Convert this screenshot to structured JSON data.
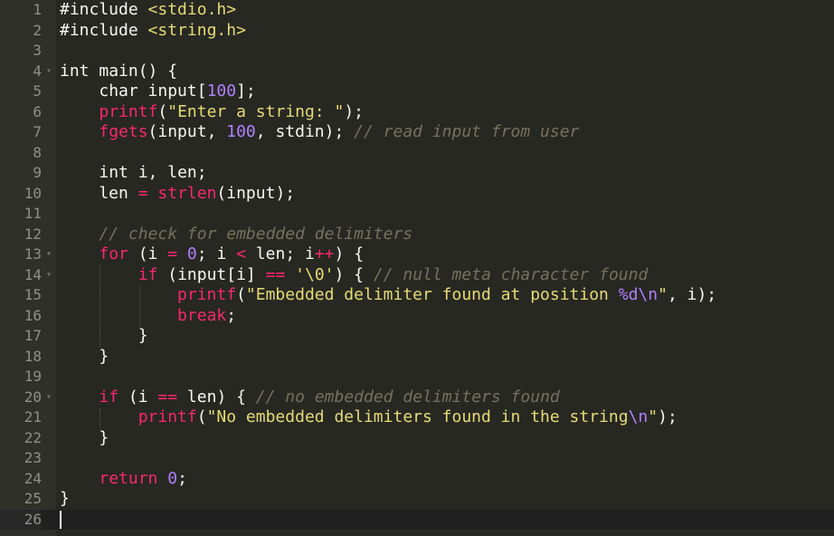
{
  "editor": {
    "lines": [
      {
        "n": "1",
        "fold": false,
        "tokens": [
          [
            "pp",
            "#include "
          ],
          [
            "str",
            "<stdio.h>"
          ]
        ]
      },
      {
        "n": "2",
        "fold": false,
        "tokens": [
          [
            "pp",
            "#include "
          ],
          [
            "str",
            "<string.h>"
          ]
        ]
      },
      {
        "n": "3",
        "fold": false,
        "tokens": []
      },
      {
        "n": "4",
        "fold": true,
        "tokens": [
          [
            "tp",
            "int "
          ],
          [
            "fn",
            "main"
          ],
          [
            "pp",
            "() {"
          ]
        ]
      },
      {
        "n": "5",
        "fold": false,
        "tokens": [
          [
            "pp",
            "    "
          ],
          [
            "tp",
            "char "
          ],
          [
            "pp",
            "input["
          ],
          [
            "num",
            "100"
          ],
          [
            "pp",
            "];"
          ]
        ]
      },
      {
        "n": "6",
        "fold": false,
        "tokens": [
          [
            "pp",
            "    "
          ],
          [
            "call",
            "printf"
          ],
          [
            "pp",
            "("
          ],
          [
            "str",
            "\"Enter a string: \""
          ],
          [
            "pp",
            ");"
          ]
        ]
      },
      {
        "n": "7",
        "fold": false,
        "tokens": [
          [
            "pp",
            "    "
          ],
          [
            "call",
            "fgets"
          ],
          [
            "pp",
            "(input, "
          ],
          [
            "num",
            "100"
          ],
          [
            "pp",
            ", stdin); "
          ],
          [
            "cm",
            "// read input from user"
          ]
        ]
      },
      {
        "n": "8",
        "fold": false,
        "tokens": []
      },
      {
        "n": "9",
        "fold": false,
        "tokens": [
          [
            "pp",
            "    "
          ],
          [
            "tp",
            "int "
          ],
          [
            "pp",
            "i, len;"
          ]
        ]
      },
      {
        "n": "10",
        "fold": false,
        "tokens": [
          [
            "pp",
            "    len "
          ],
          [
            "op",
            "="
          ],
          [
            "pp",
            " "
          ],
          [
            "call",
            "strlen"
          ],
          [
            "pp",
            "(input);"
          ]
        ]
      },
      {
        "n": "11",
        "fold": false,
        "tokens": []
      },
      {
        "n": "12",
        "fold": false,
        "tokens": [
          [
            "pp",
            "    "
          ],
          [
            "cm",
            "// check for embedded delimiters"
          ]
        ]
      },
      {
        "n": "13",
        "fold": true,
        "tokens": [
          [
            "pp",
            "    "
          ],
          [
            "kw",
            "for"
          ],
          [
            "pp",
            " (i "
          ],
          [
            "op",
            "="
          ],
          [
            "pp",
            " "
          ],
          [
            "num",
            "0"
          ],
          [
            "pp",
            "; i "
          ],
          [
            "op",
            "<"
          ],
          [
            "pp",
            " len; i"
          ],
          [
            "op",
            "++"
          ],
          [
            "pp",
            ") {"
          ]
        ]
      },
      {
        "n": "14",
        "fold": true,
        "tokens": [
          [
            "pp",
            "        "
          ],
          [
            "kw",
            "if"
          ],
          [
            "pp",
            " (input[i] "
          ],
          [
            "op",
            "=="
          ],
          [
            "pp",
            " "
          ],
          [
            "str",
            "'\\0'"
          ],
          [
            "pp",
            ") { "
          ],
          [
            "cm",
            "// null meta character found"
          ]
        ]
      },
      {
        "n": "15",
        "fold": false,
        "tokens": [
          [
            "pp",
            "            "
          ],
          [
            "call",
            "printf"
          ],
          [
            "pp",
            "("
          ],
          [
            "str",
            "\"Embedded delimiter found at position "
          ],
          [
            "esc",
            "%d\\n"
          ],
          [
            "str",
            "\""
          ],
          [
            "pp",
            ", i);"
          ]
        ]
      },
      {
        "n": "16",
        "fold": false,
        "tokens": [
          [
            "pp",
            "            "
          ],
          [
            "kw",
            "break"
          ],
          [
            "pp",
            ";"
          ]
        ]
      },
      {
        "n": "17",
        "fold": false,
        "tokens": [
          [
            "pp",
            "        }"
          ]
        ]
      },
      {
        "n": "18",
        "fold": false,
        "tokens": [
          [
            "pp",
            "    }"
          ]
        ]
      },
      {
        "n": "19",
        "fold": false,
        "tokens": []
      },
      {
        "n": "20",
        "fold": true,
        "tokens": [
          [
            "pp",
            "    "
          ],
          [
            "kw",
            "if"
          ],
          [
            "pp",
            " (i "
          ],
          [
            "op",
            "=="
          ],
          [
            "pp",
            " len) { "
          ],
          [
            "cm",
            "// no embedded delimiters found"
          ]
        ]
      },
      {
        "n": "21",
        "fold": false,
        "tokens": [
          [
            "pp",
            "        "
          ],
          [
            "call",
            "printf"
          ],
          [
            "pp",
            "("
          ],
          [
            "str",
            "\"No embedded delimiters found in the string"
          ],
          [
            "esc",
            "\\n"
          ],
          [
            "str",
            "\""
          ],
          [
            "pp",
            ");"
          ]
        ]
      },
      {
        "n": "22",
        "fold": false,
        "tokens": [
          [
            "pp",
            "    }"
          ]
        ]
      },
      {
        "n": "23",
        "fold": false,
        "tokens": []
      },
      {
        "n": "24",
        "fold": false,
        "tokens": [
          [
            "pp",
            "    "
          ],
          [
            "kw",
            "return"
          ],
          [
            "pp",
            " "
          ],
          [
            "num",
            "0"
          ],
          [
            "pp",
            ";"
          ]
        ]
      },
      {
        "n": "25",
        "fold": false,
        "tokens": [
          [
            "pp",
            "}"
          ]
        ]
      },
      {
        "n": "26",
        "fold": false,
        "active": true,
        "tokens": []
      }
    ]
  },
  "colors": {
    "background": "#272822",
    "gutter": "#2f3129",
    "keyword": "#f92672",
    "string": "#e6db74",
    "number": "#ae81ff",
    "comment": "#75715e",
    "text": "#f8f8f2"
  },
  "icons": {
    "fold": "fold-arrow-icon"
  }
}
